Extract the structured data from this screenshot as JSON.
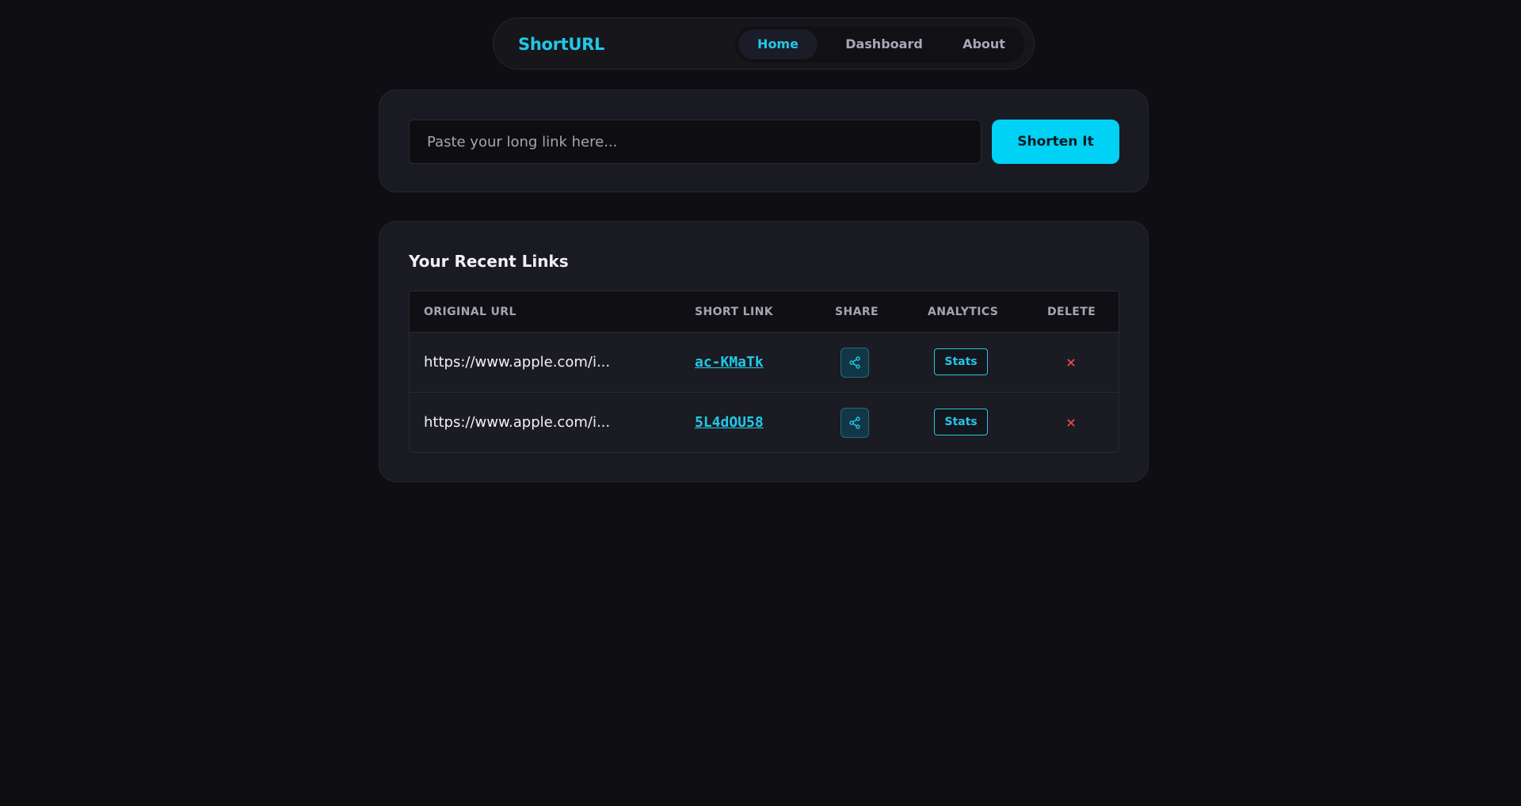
{
  "header": {
    "brand": "ShortURL",
    "nav": [
      {
        "label": "Home",
        "active": true
      },
      {
        "label": "Dashboard",
        "active": false
      },
      {
        "label": "About",
        "active": false
      }
    ]
  },
  "shorten": {
    "input_value": "",
    "placeholder": "Paste your long link here...",
    "button_label": "Shorten It"
  },
  "recent": {
    "title": "Your Recent Links",
    "columns": [
      "ORIGINAL URL",
      "SHORT LINK",
      "SHARE",
      "ANALYTICS",
      "DELETE"
    ],
    "rows": [
      {
        "original_url": "https://www.apple.com/i...",
        "short_link": "ac-KMaTk",
        "share_icon": "share-icon",
        "stats_label": "Stats",
        "delete_label": "×"
      },
      {
        "original_url": "https://www.apple.com/i...",
        "short_link": "5L4dOU58",
        "share_icon": "share-icon",
        "stats_label": "Stats",
        "delete_label": "×"
      }
    ]
  },
  "colors": {
    "background": "#0e0e13",
    "card": "#1a1a22",
    "accent": "#22c7e6",
    "button": "#00d2f5",
    "danger": "#e5484d"
  }
}
